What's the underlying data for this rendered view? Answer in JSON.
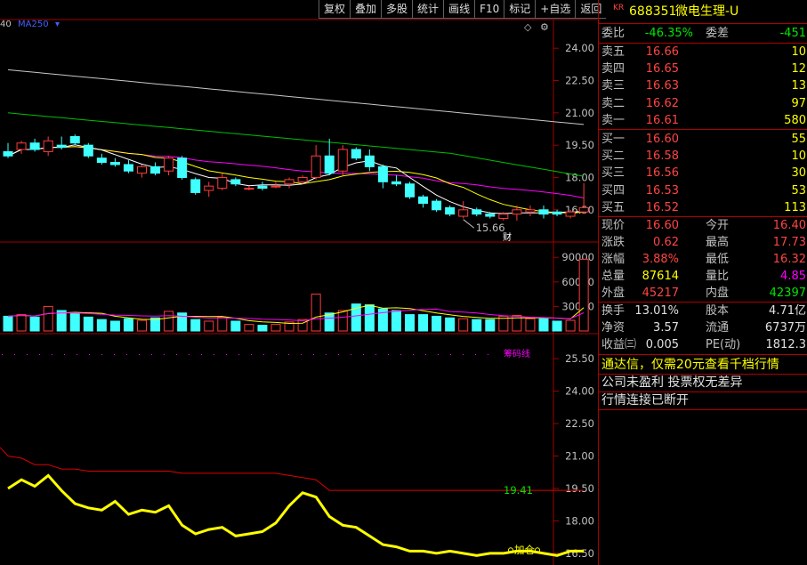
{
  "toolbar": [
    "复权",
    "叠加",
    "多股",
    "统计",
    "画线",
    "F10",
    "标记",
    "+自选",
    "返回"
  ],
  "ma_left": "40",
  "ma_label": "MA250",
  "price_axis": [
    "24.00",
    "22.50",
    "21.00",
    "19.50",
    "18.00",
    "16.50"
  ],
  "vol_axis": [
    "90000",
    "60000",
    "30000"
  ],
  "ind_axis": [
    "25.50",
    "24.00",
    "22.50",
    "21.00",
    "19.50",
    "18.00",
    "16.50"
  ],
  "low_marker": "15.66",
  "fin_tag": "财",
  "ind_name": "筹码线",
  "ind_value": "19.41",
  "ind_signal": "加仓",
  "colors": {
    "up": "#ff3b3b",
    "down": "#40ffff",
    "ma1": "#ffffff",
    "ma2": "#ffff00",
    "ma3": "#ff00ff",
    "ma4": "#00c000",
    "ma5": "#c8c8c8"
  },
  "chart_data": [
    {
      "type": "line",
      "name": "price",
      "candles": [
        [
          19.2,
          19.6,
          18.9,
          19.0
        ],
        [
          19.3,
          19.7,
          19.1,
          19.6
        ],
        [
          19.6,
          19.8,
          19.2,
          19.3
        ],
        [
          19.2,
          19.9,
          19.0,
          19.7
        ],
        [
          19.5,
          19.9,
          19.3,
          19.4
        ],
        [
          19.9,
          20.0,
          19.5,
          19.6
        ],
        [
          19.5,
          19.6,
          18.9,
          19.0
        ],
        [
          18.9,
          19.1,
          18.6,
          18.7
        ],
        [
          18.7,
          18.9,
          18.5,
          18.6
        ],
        [
          18.6,
          18.8,
          18.2,
          18.3
        ],
        [
          18.2,
          18.6,
          18.0,
          18.5
        ],
        [
          18.5,
          18.7,
          18.1,
          18.2
        ],
        [
          18.3,
          19.0,
          18.1,
          18.9
        ],
        [
          18.9,
          19.0,
          17.9,
          18.0
        ],
        [
          17.9,
          18.0,
          17.2,
          17.3
        ],
        [
          17.4,
          17.8,
          17.1,
          17.6
        ],
        [
          17.5,
          18.2,
          17.4,
          18.0
        ],
        [
          17.9,
          18.0,
          17.6,
          17.7
        ],
        [
          17.5,
          17.6,
          17.4,
          17.5
        ],
        [
          17.6,
          17.8,
          17.4,
          17.5
        ],
        [
          17.6,
          17.8,
          17.5,
          17.6
        ],
        [
          17.7,
          18.0,
          17.5,
          17.9
        ],
        [
          17.8,
          18.1,
          17.7,
          18.0
        ],
        [
          18.0,
          19.5,
          17.9,
          19.0
        ],
        [
          19.0,
          19.8,
          18.1,
          18.2
        ],
        [
          18.3,
          19.5,
          18.1,
          19.3
        ],
        [
          19.3,
          19.4,
          18.8,
          18.9
        ],
        [
          19.0,
          19.3,
          18.3,
          18.5
        ],
        [
          18.5,
          18.6,
          17.5,
          17.8
        ],
        [
          17.8,
          18.1,
          17.6,
          17.7
        ],
        [
          17.7,
          17.8,
          17.0,
          17.1
        ],
        [
          17.1,
          17.2,
          16.6,
          16.8
        ],
        [
          16.9,
          17.0,
          16.4,
          16.5
        ],
        [
          16.6,
          16.7,
          16.2,
          16.3
        ],
        [
          16.2,
          16.9,
          16.1,
          16.5
        ],
        [
          16.5,
          16.6,
          16.2,
          16.3
        ],
        [
          16.3,
          16.4,
          16.1,
          16.2
        ],
        [
          16.1,
          16.4,
          16.0,
          16.3
        ],
        [
          16.3,
          16.7,
          16.0,
          16.5
        ],
        [
          16.4,
          16.7,
          16.2,
          16.5
        ],
        [
          16.5,
          16.7,
          16.1,
          16.3
        ],
        [
          16.4,
          16.5,
          16.2,
          16.3
        ],
        [
          16.2,
          16.5,
          16.1,
          16.4
        ],
        [
          16.4,
          17.73,
          16.32,
          16.6
        ]
      ],
      "volume": [
        18000,
        20000,
        17000,
        30000,
        25000,
        22000,
        17000,
        14000,
        12000,
        15000,
        13000,
        16000,
        24000,
        22000,
        14000,
        12000,
        17000,
        12000,
        8000,
        7000,
        8000,
        11000,
        14000,
        45000,
        22000,
        25000,
        33000,
        32000,
        27000,
        25000,
        20000,
        20000,
        18000,
        16000,
        15000,
        14000,
        14000,
        18000,
        19000,
        15000,
        15000,
        12000,
        13000,
        87614
      ],
      "ylim": [
        15.5,
        25.0
      ]
    },
    {
      "type": "line",
      "name": "indicator",
      "x_note": "",
      "values": [
        19.5,
        19.9,
        19.6,
        20.1,
        19.4,
        18.8,
        18.6,
        18.5,
        18.9,
        18.3,
        18.5,
        18.4,
        18.7,
        17.8,
        17.4,
        17.6,
        17.7,
        17.3,
        17.4,
        17.5,
        17.9,
        18.7,
        19.3,
        19.1,
        18.2,
        17.8,
        17.7,
        17.3,
        16.9,
        16.8,
        16.6,
        16.6,
        16.5,
        16.6,
        16.5,
        16.4,
        16.5,
        16.5,
        16.6,
        16.6,
        16.5,
        16.4,
        16.6,
        16.6
      ],
      "line2": [
        21.0,
        20.9,
        20.6,
        20.6,
        20.4,
        20.4,
        20.3,
        20.3,
        20.3,
        20.3,
        20.3,
        20.3,
        20.3,
        20.2,
        20.2,
        20.2,
        20.2,
        20.2,
        20.2,
        20.2,
        20.2,
        20.1,
        20.0,
        19.9,
        19.41,
        19.41,
        19.41,
        19.41,
        19.41,
        19.41,
        19.41,
        19.41,
        19.41,
        19.41,
        19.41,
        19.41,
        19.41,
        19.41,
        19.41,
        19.41,
        19.41,
        19.41,
        19.41,
        19.41
      ],
      "ylim": [
        16.0,
        26.0
      ]
    }
  ],
  "quote": {
    "code_prefix": "KR",
    "code": "688351",
    "name": "微电生理-U",
    "wei_bi_label": "委比",
    "wei_bi": "-46.35%",
    "wei_cha_label": "委差",
    "wei_cha": "-451",
    "asks": [
      {
        "label": "卖五",
        "price": "16.66",
        "vol": "10"
      },
      {
        "label": "卖四",
        "price": "16.65",
        "vol": "12"
      },
      {
        "label": "卖三",
        "price": "16.63",
        "vol": "13"
      },
      {
        "label": "卖二",
        "price": "16.62",
        "vol": "97"
      },
      {
        "label": "卖一",
        "price": "16.61",
        "vol": "580"
      }
    ],
    "bids": [
      {
        "label": "买一",
        "price": "16.60",
        "vol": "55"
      },
      {
        "label": "买二",
        "price": "16.58",
        "vol": "10"
      },
      {
        "label": "买三",
        "price": "16.56",
        "vol": "30"
      },
      {
        "label": "买四",
        "price": "16.53",
        "vol": "53"
      },
      {
        "label": "买五",
        "price": "16.52",
        "vol": "113"
      }
    ],
    "stats": [
      [
        {
          "l": "现价",
          "v": "16.60",
          "c": "red"
        },
        {
          "l": "今开",
          "v": "16.40",
          "c": "red"
        }
      ],
      [
        {
          "l": "涨跌",
          "v": "0.62",
          "c": "red"
        },
        {
          "l": "最高",
          "v": "17.73",
          "c": "red"
        }
      ],
      [
        {
          "l": "涨幅",
          "v": "3.88%",
          "c": "red"
        },
        {
          "l": "最低",
          "v": "16.32",
          "c": "red"
        }
      ],
      [
        {
          "l": "总量",
          "v": "87614",
          "c": "yellow"
        },
        {
          "l": "量比",
          "v": "4.85",
          "c": "magenta"
        }
      ],
      [
        {
          "l": "外盘",
          "v": "45217",
          "c": "red"
        },
        {
          "l": "内盘",
          "v": "42397",
          "c": "green"
        }
      ]
    ],
    "stats2": [
      [
        {
          "l": "换手",
          "v": "13.01%"
        },
        {
          "l": "股本",
          "v": "4.71亿"
        }
      ],
      [
        {
          "l": "净资",
          "v": "3.57"
        },
        {
          "l": "流通",
          "v": "6737万"
        }
      ],
      [
        {
          "l": "收益㈢",
          "v": "0.005"
        },
        {
          "l": "PE(动)",
          "v": "1812.3"
        }
      ]
    ],
    "promo": "通达信，仅需20元查看千档行情",
    "notice": "公司未盈利 投票权无差异",
    "status": "行情连接已断开"
  }
}
